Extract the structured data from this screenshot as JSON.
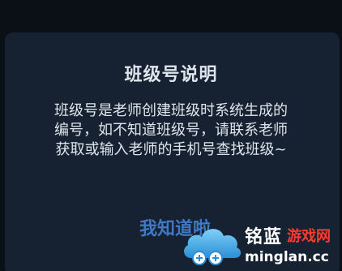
{
  "dialog": {
    "title": "班级号说明",
    "body_lines": [
      "班级号是老师创建班级时系统生成的",
      "编号，如不知道班级号，请联系老师",
      "获取或输入老师的手机号查找班级~"
    ],
    "confirm_label": "我知道啦"
  },
  "watermark": {
    "brand": "铭蓝",
    "brand_sub": "游戏网",
    "domain": "minglan.cc"
  },
  "colors": {
    "background": "#0b1017",
    "dialog": "#162231",
    "text": "#dfe5ec",
    "accent": "#3f78c3",
    "watermark_red": "#ff3b30"
  }
}
